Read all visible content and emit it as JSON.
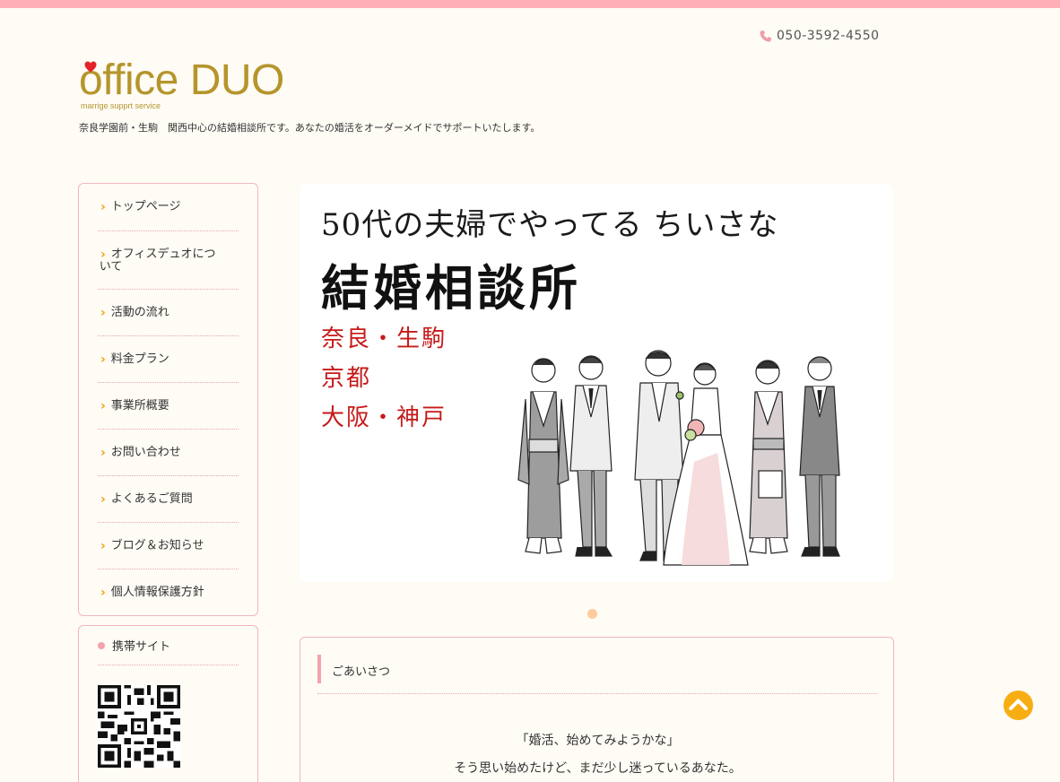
{
  "header": {
    "phone": "050-3592-4550",
    "logo_main": "office DUO",
    "logo_sub": "marrige supprt service",
    "tagline": "奈良学園前・生駒　関西中心の結婚相談所です。あなたの婚活をオーダーメイドでサポートいたします。"
  },
  "nav": {
    "items": [
      {
        "label": "トップページ"
      },
      {
        "label": "オフィスデュオにつ"
      },
      {
        "label": "活動の流れ"
      },
      {
        "label": "料金プラン"
      },
      {
        "label": "事業所概要"
      },
      {
        "label": "お問い合わせ"
      },
      {
        "label": "よくあるご質問"
      },
      {
        "label": "ブログ＆お知らせ"
      },
      {
        "label": "個人情報保護方針"
      }
    ],
    "item2_cont": "いて"
  },
  "mobile": {
    "title": "携帯サイト"
  },
  "hero": {
    "line1": "50代の夫婦でやってる ちいさな",
    "line2": "結婚相談所",
    "places": [
      "奈良・生駒",
      "京都",
      "大阪・神戸"
    ]
  },
  "greeting": {
    "heading": "ごあいさつ",
    "line1": "「婚活、始めてみようかな」",
    "line2": "そう思い始めたけど、まだ少し迷っているあなた。"
  },
  "colors": {
    "accent_pink": "#ffadb7",
    "gold": "#b5952b",
    "chevron": "#f2a20c",
    "hero_red": "#c61a1a",
    "totop": "#f7ae13"
  }
}
